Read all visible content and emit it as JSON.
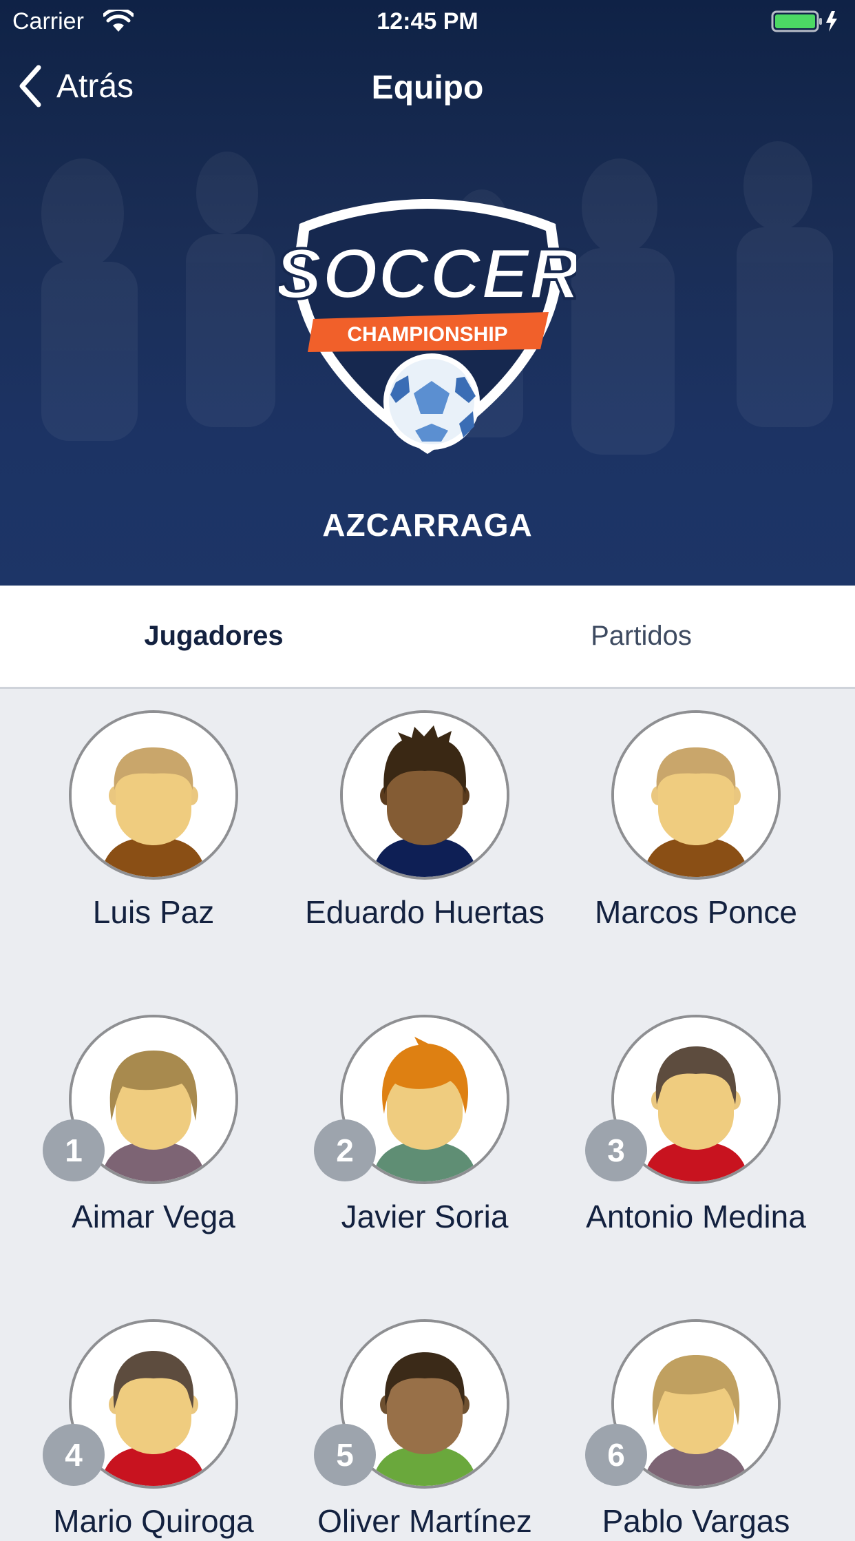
{
  "status_bar": {
    "carrier": "Carrier",
    "time": "12:45 PM"
  },
  "nav": {
    "back_label": "Atrás",
    "title": "Equipo"
  },
  "logo": {
    "word": "SOCCER",
    "banner": "CHAMPIONSHIP"
  },
  "team": {
    "name": "AZCARRAGA"
  },
  "tabs": [
    {
      "label": "Jugadores",
      "active": true
    },
    {
      "label": "Partidos",
      "active": false
    }
  ],
  "players": [
    {
      "name": "Luis Paz",
      "number": "",
      "avatar": "avatar-blond-brown-shirt"
    },
    {
      "name": "Eduardo Huertas",
      "number": "",
      "avatar": "avatar-spiky-dark-navy-shirt"
    },
    {
      "name": "Marcos Ponce",
      "number": "",
      "avatar": "avatar-blond-brown-shirt"
    },
    {
      "name": "Aimar Vega",
      "number": "1",
      "avatar": "avatar-long-hair-mauve-shirt"
    },
    {
      "name": "Javier Soria",
      "number": "2",
      "avatar": "avatar-orange-hair-green-shirt"
    },
    {
      "name": "Antonio Medina",
      "number": "3",
      "avatar": "avatar-brown-hair-red-shirt"
    },
    {
      "name": "Mario Quiroga",
      "number": "4",
      "avatar": "avatar-brown-hair-red-shirt"
    },
    {
      "name": "Oliver Martínez",
      "number": "5",
      "avatar": "avatar-dark-skin-green-shirt"
    },
    {
      "name": "Pablo Vargas",
      "number": "6",
      "avatar": "avatar-long-hair-mauve-shirt"
    }
  ],
  "colors": {
    "header_bg": "#16284f",
    "badge_bg": "#9da4ad",
    "text_dark": "#13213f",
    "logo_orange": "#f1602a"
  }
}
